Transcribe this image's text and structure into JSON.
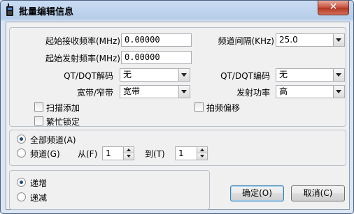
{
  "window": {
    "title": "批量编辑信息",
    "close_label": "✕"
  },
  "frequency": {
    "rx_start_label": "起始接收频率(MHz)",
    "rx_start_value": "0.00000",
    "tx_start_label": "起始发射频率(MHz)",
    "tx_start_value": "0.00000",
    "step_label": "频道间隔(KHz)",
    "step_value": "25.0"
  },
  "qt_decode": {
    "label": "QT/DQT解码",
    "value": "无"
  },
  "qt_encode": {
    "label": "QT/DQT编码",
    "value": "无"
  },
  "bandwidth": {
    "label": "宽带/窄带",
    "value": "宽带"
  },
  "tx_power": {
    "label": "发射功率",
    "value": "高"
  },
  "checkboxes": {
    "scan_add": "扫描添加",
    "busy_lock": "繁忙锁定",
    "freq_hop": "拍频偏移"
  },
  "channel_range": {
    "all_label": "全部频道(A)",
    "range_label": "频道(G)",
    "from_label": "从(F)",
    "from_value": "1",
    "to_label": "到(T)",
    "to_value": "1",
    "selected": "all"
  },
  "order": {
    "increment_label": "递增",
    "decrement_label": "递减",
    "selected": "increment"
  },
  "buttons": {
    "ok_label": "确定(O)",
    "cancel_label": "取消(C)"
  },
  "colors": {
    "title_bar": "#b6cde9",
    "close_button": "#c7503b",
    "dialog_bg": "#f0f0f0"
  }
}
